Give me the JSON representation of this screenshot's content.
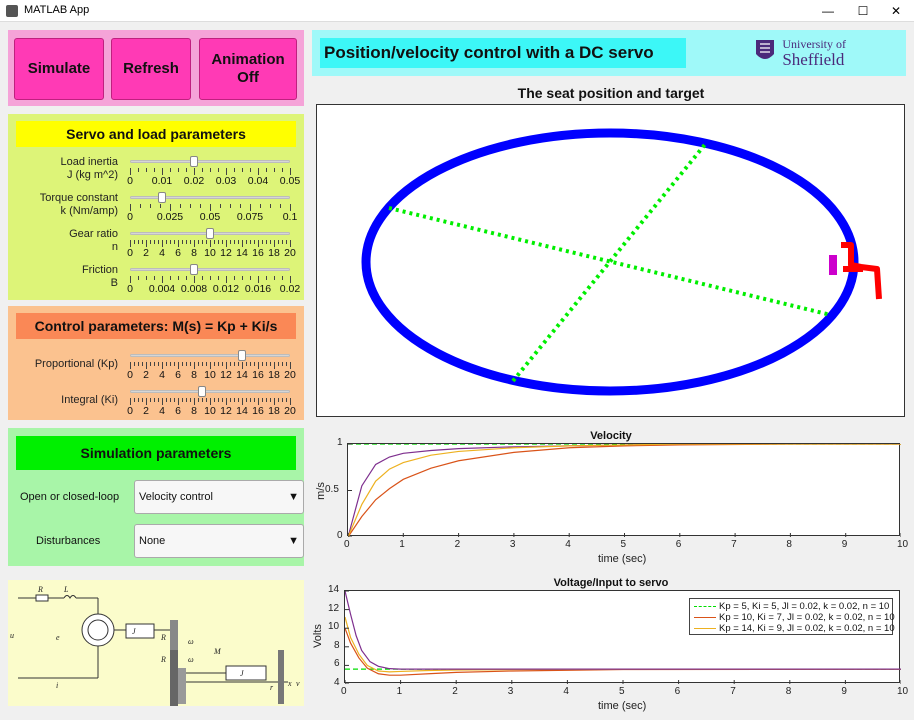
{
  "window": {
    "title": "MATLAB App",
    "minimize": "—",
    "maximize": "☐",
    "close": "✕"
  },
  "buttons": {
    "simulate": "Simulate",
    "refresh": "Refresh",
    "animation_line1": "Animation",
    "animation_line2": "Off"
  },
  "servo": {
    "header": "Servo and load  parameters",
    "params": [
      {
        "label1": "Load inertia",
        "label2": "J (kg m^2)",
        "ticks": [
          "0",
          "0.01",
          "0.02",
          "0.03",
          "0.04",
          "0.05"
        ],
        "value": 0.02,
        "min": 0,
        "max": 0.05
      },
      {
        "label1": "Torque constant",
        "label2": "k (Nm/amp)",
        "ticks": [
          "0",
          "0.025",
          "0.05",
          "0.075",
          "0.1"
        ],
        "value": 0.02,
        "min": 0,
        "max": 0.1
      },
      {
        "label1": "Gear ratio",
        "label2": "n",
        "ticks": [
          "0",
          "2",
          "4",
          "6",
          "8",
          "10",
          "12",
          "14",
          "16",
          "18",
          "20"
        ],
        "value": 10,
        "min": 0,
        "max": 20
      },
      {
        "label1": "Friction",
        "label2": "B",
        "ticks": [
          "0",
          "0.004",
          "0.008",
          "0.012",
          "0.016",
          "0.02"
        ],
        "value": 0.008,
        "min": 0,
        "max": 0.02
      }
    ]
  },
  "control": {
    "header": "Control parameters: M(s) = Kp + Ki/s",
    "params": [
      {
        "label": "Proportional (Kp)",
        "ticks": [
          "0",
          "2",
          "4",
          "6",
          "8",
          "10",
          "12",
          "14",
          "16",
          "18",
          "20"
        ],
        "value": 14,
        "min": 0,
        "max": 20
      },
      {
        "label": "Integral (Ki)",
        "ticks": [
          "0",
          "2",
          "4",
          "6",
          "8",
          "10",
          "12",
          "14",
          "16",
          "18",
          "20"
        ],
        "value": 9,
        "min": 0,
        "max": 20
      }
    ]
  },
  "simulation": {
    "header": "Simulation parameters",
    "loop_label": "Open or closed-loop",
    "loop_value": "Velocity control",
    "dist_label": "Disturbances",
    "dist_value": "None",
    "arrow": "▼"
  },
  "banner": {
    "title": "Position/velocity control with a DC servo",
    "logo_line1": "University of",
    "logo_line2": "Sheffield"
  },
  "schematic": {
    "labels": [
      "R_a",
      "L_a",
      "u_a",
      "e_a",
      "i_a",
      "J_M",
      "R_1",
      "R_2",
      "ω_M",
      "ω_L",
      "M_L",
      "J_L",
      "r",
      "x",
      "v"
    ]
  },
  "colors": {
    "blue": "#0000ff",
    "green": "#00ee00",
    "red": "#ff0000",
    "purple": "#7e2f8e",
    "orange_red": "#d95319",
    "yellow_orange": "#edb120"
  },
  "chart_data": [
    {
      "type": "scatter",
      "title": "The seat position and target",
      "description_series": [
        {
          "name": "track",
          "shape": "ellipse"
        },
        {
          "name": "diagonals",
          "style": "dotted green"
        }
      ]
    },
    {
      "type": "line",
      "title": "Velocity",
      "xlabel": "time (sec)",
      "ylabel": "m/s",
      "xlim": [
        0,
        10
      ],
      "ylim": [
        0,
        1
      ],
      "xticks": [
        "0",
        "1",
        "2",
        "3",
        "4",
        "5",
        "6",
        "7",
        "8",
        "9",
        "10"
      ],
      "yticks": [
        "0",
        "0.5",
        "1"
      ],
      "series": [
        {
          "name": "target",
          "style": "dashed",
          "color": "#00dd00",
          "x": [
            0,
            10
          ],
          "y": [
            1,
            1
          ]
        },
        {
          "color": "#7e2f8e",
          "x": [
            0,
            0.25,
            0.5,
            0.75,
            1,
            1.5,
            2,
            3,
            4,
            5,
            6,
            8,
            10
          ],
          "y": [
            0,
            0.55,
            0.78,
            0.86,
            0.9,
            0.93,
            0.95,
            0.97,
            0.98,
            0.99,
            1,
            1,
            1
          ]
        },
        {
          "color": "#d95319",
          "x": [
            0,
            0.25,
            0.5,
            0.75,
            1,
            1.5,
            2,
            3,
            4,
            5,
            6,
            8,
            10
          ],
          "y": [
            0,
            0.22,
            0.4,
            0.52,
            0.62,
            0.74,
            0.82,
            0.91,
            0.96,
            0.98,
            0.99,
            1,
            1
          ]
        },
        {
          "color": "#edb120",
          "x": [
            0,
            0.25,
            0.5,
            0.75,
            1,
            1.5,
            2,
            3,
            4,
            5,
            6,
            8,
            10
          ],
          "y": [
            0,
            0.35,
            0.6,
            0.73,
            0.8,
            0.88,
            0.92,
            0.96,
            0.98,
            0.99,
            1,
            1,
            1
          ]
        }
      ]
    },
    {
      "type": "line",
      "title": "Voltage/Input to servo",
      "xlabel": "time (sec)",
      "ylabel": "Volts",
      "xlim": [
        0,
        10
      ],
      "ylim": [
        4,
        14
      ],
      "xticks": [
        "0",
        "1",
        "2",
        "3",
        "4",
        "5",
        "6",
        "7",
        "8",
        "9",
        "10"
      ],
      "yticks": [
        "4",
        "6",
        "8",
        "10",
        "12",
        "14"
      ],
      "legend": "top-right",
      "series": [
        {
          "name": "Kp = 5, Ki = 5, Jl = 0.02, k = 0.02, n = 10",
          "style": "dashed",
          "color": "#00dd00",
          "x": [
            0,
            10
          ],
          "y": [
            5.6,
            5.6
          ]
        },
        {
          "name": "Kp = 10, Ki = 7, Jl = 0.02, k = 0.02, n = 10",
          "color": "#d95319",
          "x": [
            0,
            0.1,
            0.25,
            0.4,
            0.6,
            0.8,
            1,
            1.5,
            2,
            3,
            5,
            10
          ],
          "y": [
            10,
            8.4,
            6.8,
            5.7,
            5.1,
            4.95,
            4.95,
            5.1,
            5.25,
            5.4,
            5.55,
            5.6
          ]
        },
        {
          "name": "Kp = 14, Ki = 9, Jl = 0.02, k = 0.02, n = 10",
          "color": "#edb120",
          "x": [
            0,
            0.1,
            0.25,
            0.4,
            0.6,
            0.8,
            1,
            1.5,
            2,
            3,
            5,
            10
          ],
          "y": [
            11.2,
            9.0,
            7.2,
            6.0,
            5.4,
            5.3,
            5.35,
            5.45,
            5.5,
            5.55,
            5.6,
            5.6
          ]
        },
        {
          "color": "#7e2f8e",
          "x": [
            0,
            0.1,
            0.2,
            0.3,
            0.45,
            0.6,
            0.8,
            1,
            1.5,
            2,
            3,
            5,
            10
          ],
          "y": [
            14,
            11.5,
            9.2,
            7.6,
            6.4,
            5.9,
            5.65,
            5.6,
            5.6,
            5.6,
            5.6,
            5.6,
            5.6
          ]
        }
      ]
    }
  ]
}
